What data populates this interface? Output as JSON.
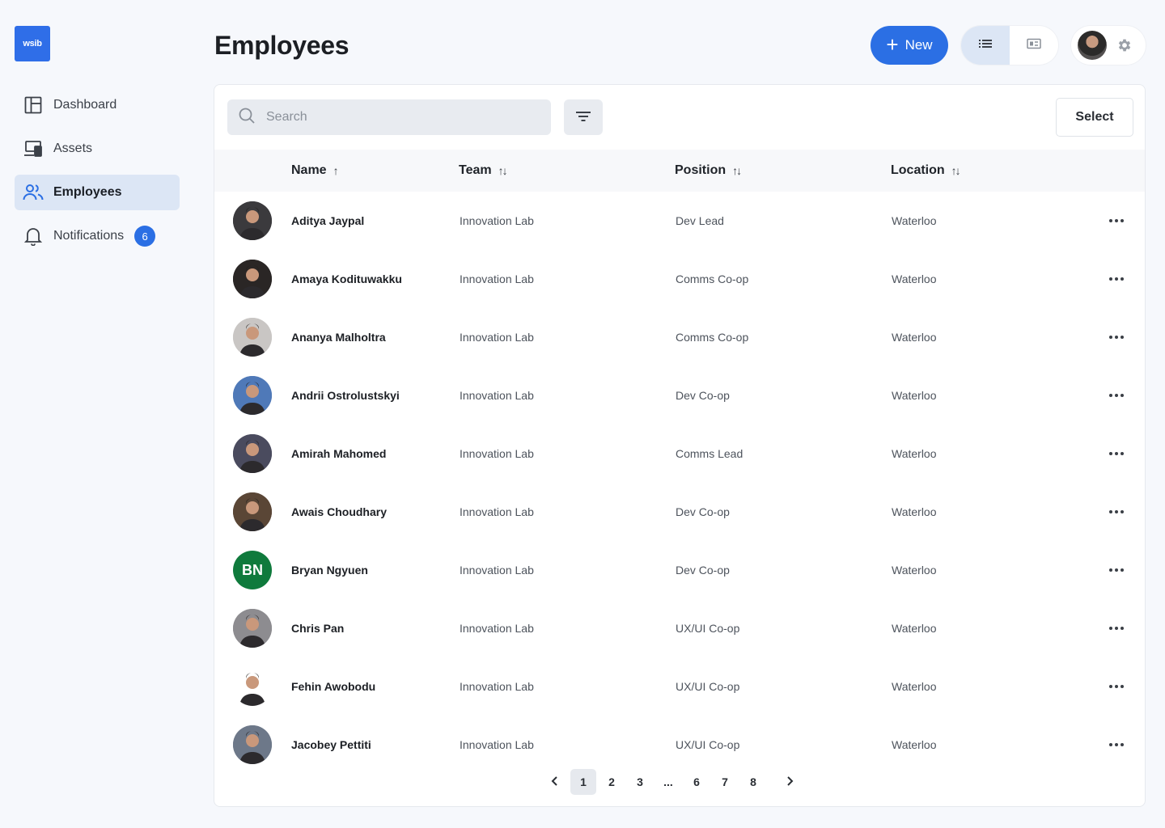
{
  "logo": {
    "text": "wsib"
  },
  "sidebar": {
    "items": [
      {
        "label": "Dashboard",
        "icon": "dashboard-icon",
        "active": false
      },
      {
        "label": "Assets",
        "icon": "assets-icon",
        "active": false
      },
      {
        "label": "Employees",
        "icon": "people-icon",
        "active": true
      },
      {
        "label": "Notifications",
        "icon": "bell-icon",
        "active": false,
        "badge": "6"
      }
    ]
  },
  "header": {
    "title": "Employees",
    "new_label": "New",
    "new_icon": "plus-icon"
  },
  "toolbar": {
    "search_placeholder": "Search",
    "select_label": "Select"
  },
  "table": {
    "columns": [
      {
        "label": "Name",
        "sort": "↑"
      },
      {
        "label": "Team",
        "sort": "↑↓"
      },
      {
        "label": "Position",
        "sort": "↑↓"
      },
      {
        "label": "Location",
        "sort": "↑↓"
      }
    ],
    "rows": [
      {
        "name": "Aditya Jaypal",
        "team": "Innovation Lab",
        "position": "Dev Lead",
        "location": "Waterloo",
        "avatar_color": "#3b3a3d"
      },
      {
        "name": "Amaya Kodituwakku",
        "team": "Innovation Lab",
        "position": "Comms Co-op",
        "location": "Waterloo",
        "avatar_color": "#2a2625"
      },
      {
        "name": "Ananya Malholtra",
        "team": "Innovation Lab",
        "position": "Comms Co-op",
        "location": "Waterloo",
        "avatar_color": "#c9c6c4"
      },
      {
        "name": "Andrii Ostrolustskyi",
        "team": "Innovation Lab",
        "position": "Dev Co-op",
        "location": "Waterloo",
        "avatar_color": "#4f79b8"
      },
      {
        "name": "Amirah Mahomed",
        "team": "Innovation Lab",
        "position": "Comms Lead",
        "location": "Waterloo",
        "avatar_color": "#4a4b5e"
      },
      {
        "name": "Awais Choudhary",
        "team": "Innovation Lab",
        "position": "Dev Co-op",
        "location": "Waterloo",
        "avatar_color": "#5a4636"
      },
      {
        "name": "Bryan Ngyuen",
        "team": "Innovation Lab",
        "position": "Dev Co-op",
        "location": "Waterloo",
        "avatar_color": "#0f7a3c",
        "initials": "BN"
      },
      {
        "name": "Chris Pan",
        "team": "Innovation Lab",
        "position": "UX/UI Co-op",
        "location": "Waterloo",
        "avatar_color": "#8d8c90"
      },
      {
        "name": "Fehin Awobodu",
        "team": "Innovation Lab",
        "position": "UX/UI Co-op",
        "location": "Waterloo",
        "avatar_color": "#ffffff"
      },
      {
        "name": "Jacobey Pettiti",
        "team": "Innovation Lab",
        "position": "UX/UI Co-op",
        "location": "Waterloo",
        "avatar_color": "#6d7889"
      }
    ]
  },
  "pagination": {
    "pages": [
      "1",
      "2",
      "3",
      "...",
      "6",
      "7",
      "8"
    ],
    "current": "1"
  },
  "colors": {
    "accent": "#2b6fe4",
    "active_bg": "#dce6f5"
  }
}
